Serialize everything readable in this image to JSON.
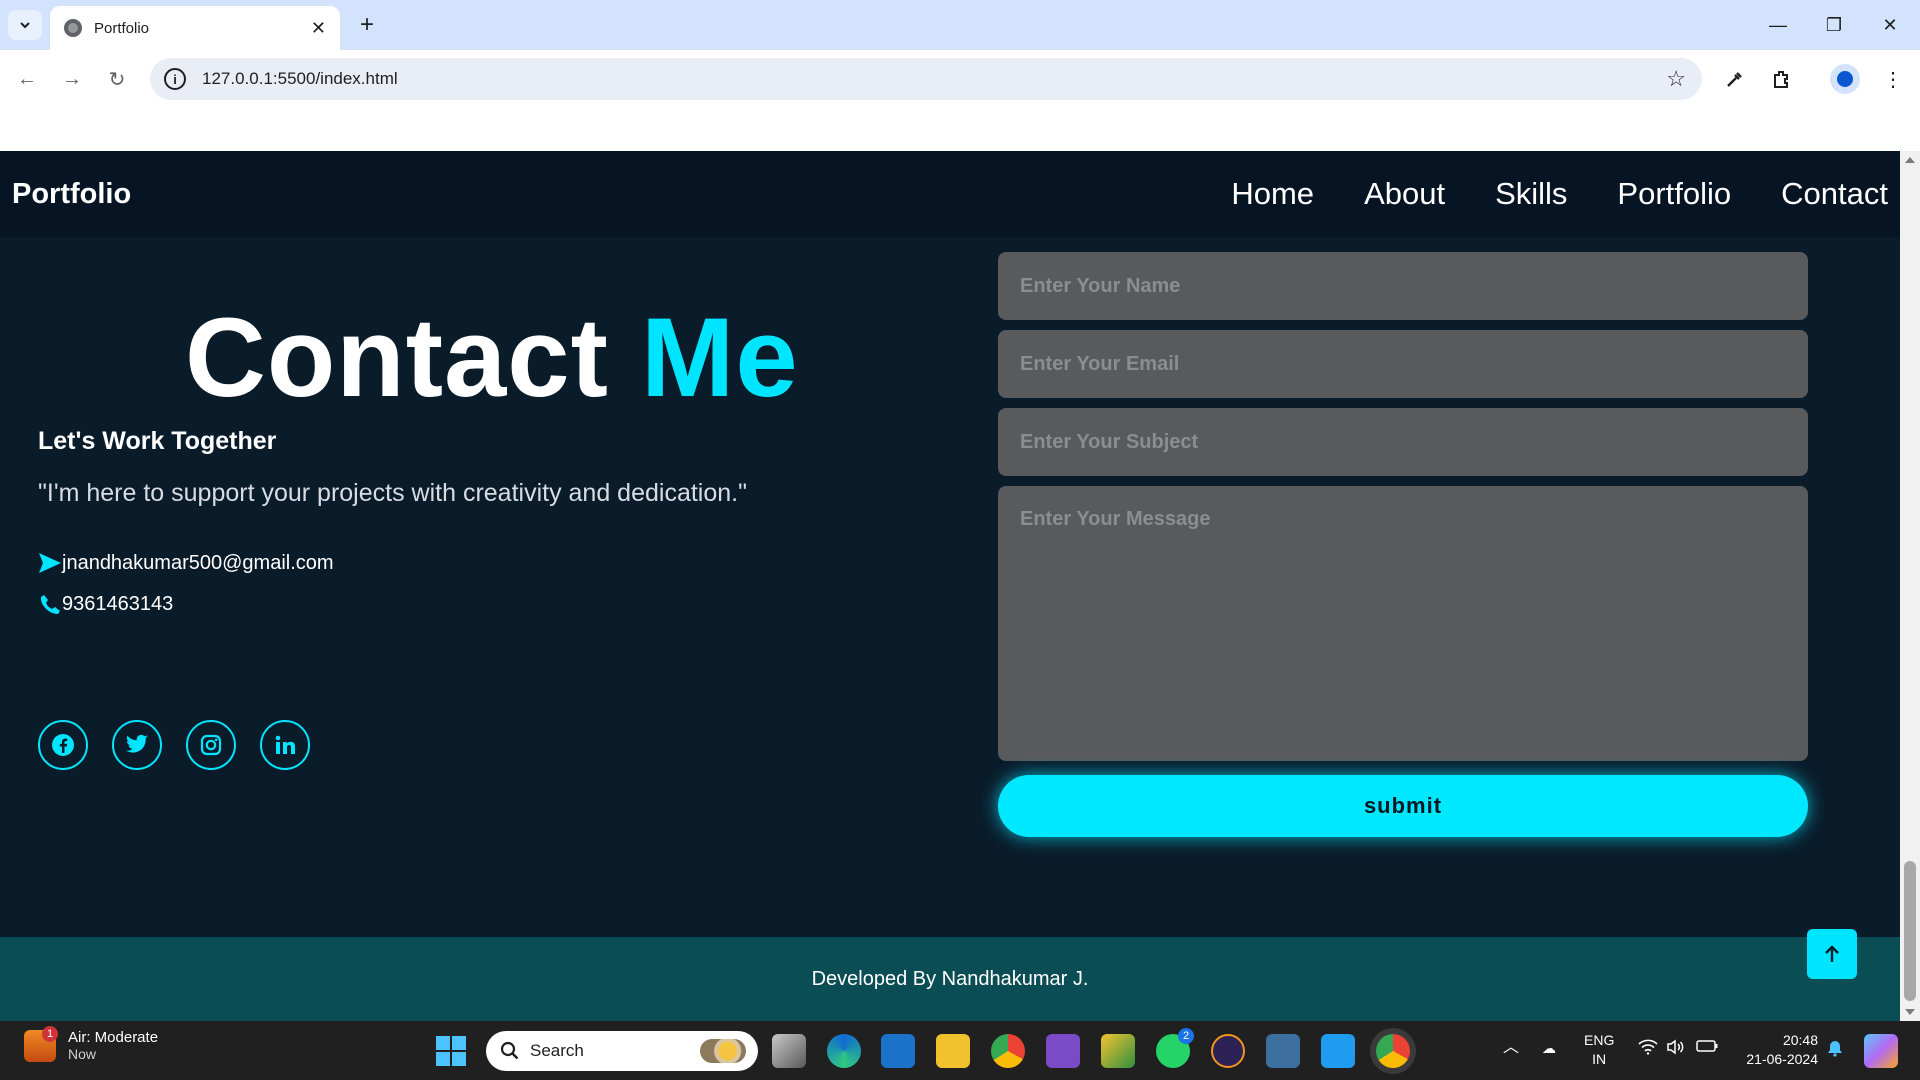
{
  "browser": {
    "tab_title": "Portfolio",
    "url": "127.0.0.1:5500/index.html"
  },
  "site": {
    "logo": "Portfolio",
    "nav": [
      "Home",
      "About",
      "Skills",
      "Portfolio",
      "Contact"
    ],
    "contact": {
      "heading_main": "Contact",
      "heading_accent": "Me",
      "subheading": "Let's Work Together",
      "quote": "\"I'm here to support your projects with creativity and dedication.\"",
      "email": "jnandhakumar500@gmail.com",
      "phone": "9361463143",
      "socials": [
        "facebook-icon",
        "twitter-icon",
        "instagram-icon",
        "linkedin-icon"
      ]
    },
    "form": {
      "name_placeholder": "Enter Your Name",
      "email_placeholder": "Enter Your Email",
      "subject_placeholder": "Enter Your Subject",
      "message_placeholder": "Enter Your Message",
      "submit_label": "submit"
    },
    "footer": "Developed By Nandhakumar J."
  },
  "taskbar": {
    "weather_title": "Air: Moderate",
    "weather_sub": "Now",
    "weather_badge": "1",
    "search_label": "Search",
    "whatsapp_badge": "2",
    "lang_1": "ENG",
    "lang_2": "IN",
    "time": "20:48",
    "date": "21-06-2024"
  },
  "colors": {
    "accent": "#00e5ff",
    "page_bg": "#0a1b2a",
    "header_bg": "#061424",
    "footer_bg": "#0b4d55",
    "field_bg": "#595a5c"
  }
}
